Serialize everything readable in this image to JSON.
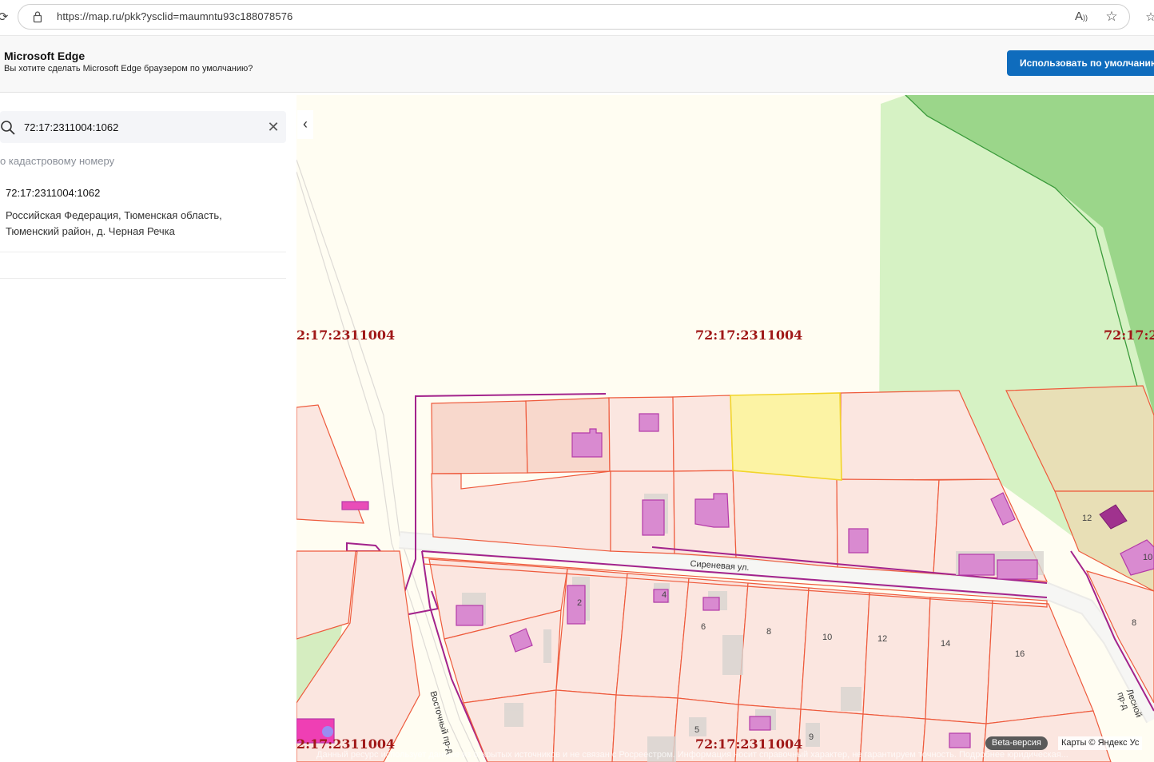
{
  "browser": {
    "url": "https://map.ru/pkk?ysclid=maumntu93c188078576",
    "read_aloud_icon": "read-aloud-icon",
    "favorite_icon": "star-icon"
  },
  "banner": {
    "title": "Microsoft Edge",
    "text": "Вы хотите сделать Microsoft Edge браузером по умолчанию?",
    "button": "Использовать по умолчанию"
  },
  "search": {
    "value": "72:17:2311004:1062",
    "icon": "search-icon",
    "clear_icon": "close-icon"
  },
  "results": {
    "section_label": "о кадастровому номеру",
    "items": [
      {
        "number": "72:17:2311004:1062",
        "address": "Российская Федерация, Тюменская область, Тюменский район, д. Черная Речка"
      }
    ]
  },
  "map": {
    "quarter_labels": [
      "2:17:2311004",
      "72:17:2311004",
      "72:17:2",
      "2:17:2311004",
      "72:17:2311004"
    ],
    "street_east": "Сиреневая ул.",
    "street_vost": "Восточный пр-д",
    "street_les": "Лесной пр-д",
    "house_numbers": [
      "12",
      "10",
      "8",
      "2",
      "4",
      "6",
      "8",
      "10",
      "12",
      "14",
      "16",
      "5",
      "9"
    ],
    "beta": "Beta-версия",
    "copyright": "Карты © Яндекс  Ус",
    "disclaimer": "Данный ресурс использует данные из открытых источников и не связан с Росреестром. Информация носит справочный характер, не гарантируем точность. Подробнее юридическая..."
  },
  "colors": {
    "parcel_fill": "#fbe6e0",
    "parcel_stroke": "#ee5a3c",
    "selected_fill": "#fcf3a4",
    "building_fill": "#d98ad0",
    "forest": "#d3f0bf",
    "quarter_label": "#a01818"
  }
}
